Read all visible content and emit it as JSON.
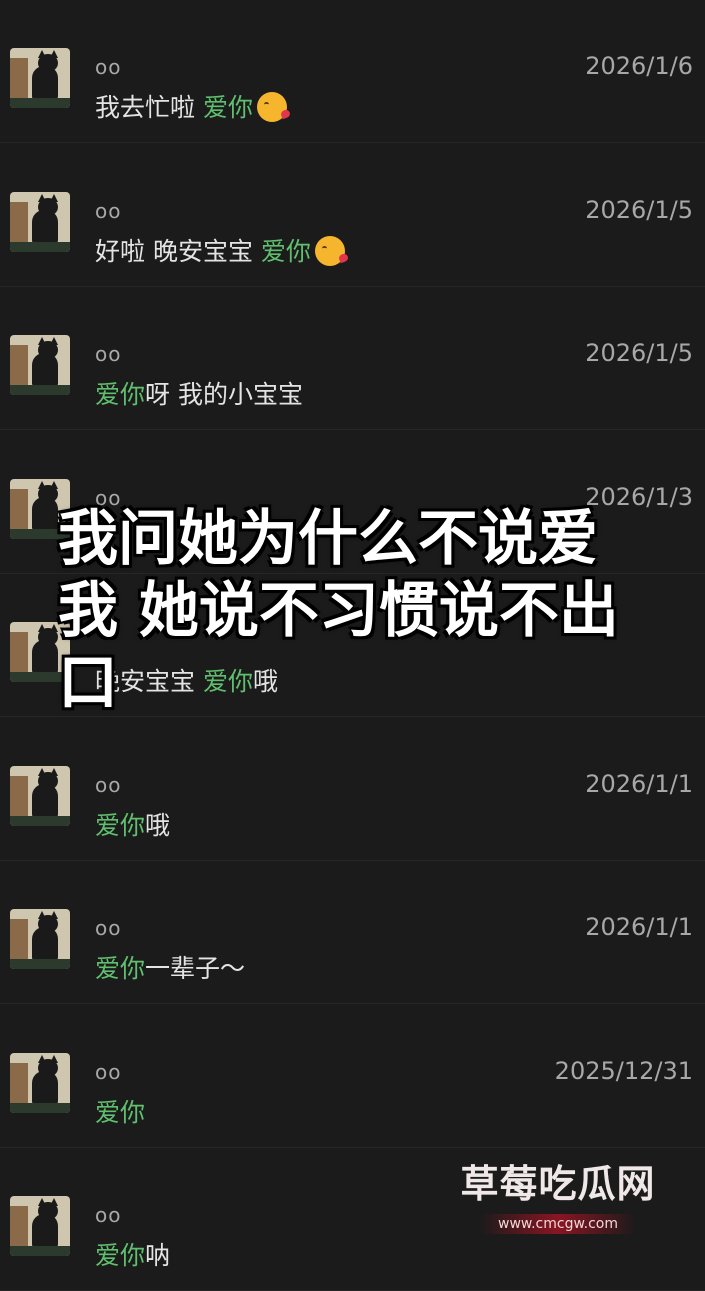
{
  "messages": [
    {
      "name": "oo",
      "date": "2026/1/6",
      "parts": [
        {
          "text": "我去忙啦 ",
          "hl": false
        },
        {
          "text": "爱你",
          "hl": true
        }
      ],
      "emoji": "kissing-heart"
    },
    {
      "name": "oo",
      "date": "2026/1/5",
      "parts": [
        {
          "text": "好啦 晚安宝宝 ",
          "hl": false
        },
        {
          "text": "爱你",
          "hl": true
        }
      ],
      "emoji": "kissing-heart"
    },
    {
      "name": "oo",
      "date": "2026/1/5",
      "parts": [
        {
          "text": "爱你",
          "hl": true
        },
        {
          "text": "呀 我的小宝宝",
          "hl": false
        }
      ],
      "emoji": ""
    },
    {
      "name": "oo",
      "date": "2026/1/3",
      "parts": [],
      "emoji": ""
    },
    {
      "name": "",
      "date": "",
      "parts": [
        {
          "text": "晚安宝宝 ",
          "hl": false
        },
        {
          "text": "爱你",
          "hl": true
        },
        {
          "text": "哦",
          "hl": false
        }
      ],
      "emoji": ""
    },
    {
      "name": "oo",
      "date": "2026/1/1",
      "parts": [
        {
          "text": "爱你",
          "hl": true
        },
        {
          "text": "哦",
          "hl": false
        }
      ],
      "emoji": ""
    },
    {
      "name": "oo",
      "date": "2026/1/1",
      "parts": [
        {
          "text": "爱你",
          "hl": true
        },
        {
          "text": "一辈子～",
          "hl": false
        }
      ],
      "emoji": ""
    },
    {
      "name": "oo",
      "date": "2025/12/31",
      "parts": [
        {
          "text": "爱你",
          "hl": true
        }
      ],
      "emoji": ""
    },
    {
      "name": "oo",
      "date": "",
      "parts": [
        {
          "text": "爱你",
          "hl": true
        },
        {
          "text": "呐",
          "hl": false
        }
      ],
      "emoji": ""
    }
  ],
  "overlay": {
    "line1": "我问她为什么不说爱",
    "line2": "我 她说不习惯说不出",
    "line3": "口"
  },
  "watermark": {
    "title": "草莓吃瓜网",
    "url": "www.cmcgw.com"
  },
  "colors": {
    "background": "#1b1b1b",
    "highlight": "#5fbf6e",
    "text": "#e4e4e4",
    "meta": "#a8a8a8"
  }
}
